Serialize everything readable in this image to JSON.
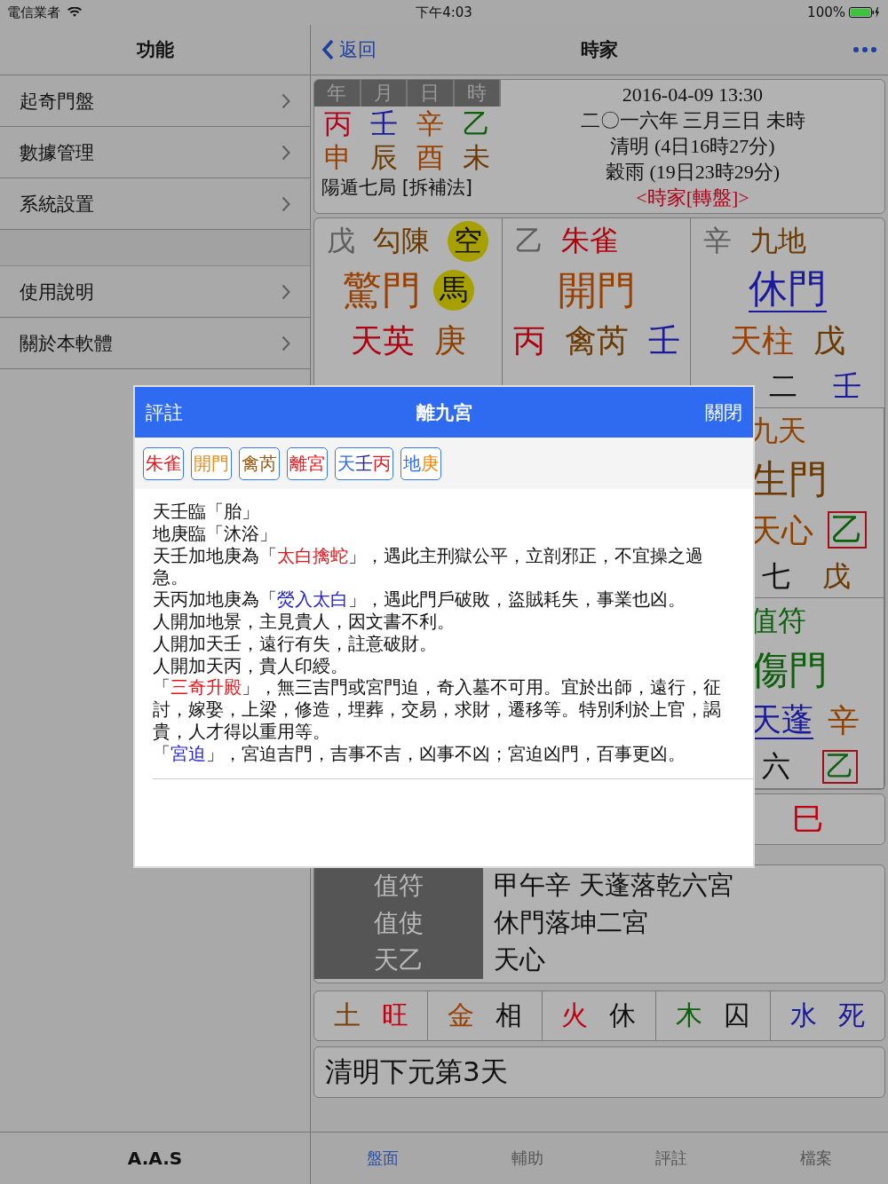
{
  "status_bar": {
    "carrier": "電信業者",
    "time": "下午4:03",
    "battery": "100%"
  },
  "sidebar": {
    "title": "功能",
    "groups": [
      [
        {
          "label": "起奇門盤"
        },
        {
          "label": "數據管理"
        },
        {
          "label": "系統設置"
        }
      ],
      [
        {
          "label": "使用說明"
        },
        {
          "label": "關於本軟體"
        }
      ]
    ],
    "footer": "A.A.S"
  },
  "nav": {
    "back": "返回",
    "title": "時家"
  },
  "chart_info": {
    "pillar_headers": [
      "年",
      "月",
      "日",
      "時"
    ],
    "stems": [
      {
        "text": "丙",
        "color": "#b0001a"
      },
      {
        "text": "壬",
        "color": "#1a1a9a"
      },
      {
        "text": "辛",
        "color": "#9a4000"
      },
      {
        "text": "乙",
        "color": "#0e600e"
      }
    ],
    "branches": [
      {
        "text": "申",
        "color": "#9a4000"
      },
      {
        "text": "辰",
        "color": "#6b3a00"
      },
      {
        "text": "酉",
        "color": "#9a4000"
      },
      {
        "text": "未",
        "color": "#6b3a00"
      }
    ],
    "ju": "陽遁七局 [拆補法]",
    "lines": [
      "2016-04-09 13:30",
      "二〇一六年 三月三日 未時",
      "清明 (4日16時27分)",
      "穀雨 (19日23時29分)"
    ],
    "link": "<時家[轉盤]>"
  },
  "palaces": [
    {
      "heaven_line": [
        {
          "text": "戊",
          "color": "#5e5e5e",
          "kind": "plain"
        },
        {
          "text": "勾陳",
          "color": "#6b3a00",
          "kind": "plain"
        },
        {
          "text": "空",
          "kind": "circle"
        }
      ],
      "door_line": [
        {
          "text": "驚門",
          "color": "#9a4000",
          "kind": "plain"
        },
        {
          "text": "馬",
          "kind": "circle"
        }
      ],
      "star_line": [
        {
          "text": "天英",
          "color": "#b0000e",
          "kind": "plain"
        },
        {
          "text": "庚",
          "color": "#8f4200",
          "kind": "plain"
        }
      ]
    },
    {
      "heaven_line": [
        {
          "text": "乙",
          "color": "#5e5e5e",
          "kind": "plain"
        },
        {
          "text": "朱雀",
          "color": "#b0000e",
          "kind": "plain"
        }
      ],
      "door_line": [
        {
          "text": "開門",
          "color": "#9a4000",
          "kind": "plain"
        }
      ],
      "star_line": [
        {
          "text": "丙",
          "color": "#b0000e",
          "kind": "plain"
        },
        {
          "text": "禽芮",
          "color": "#6b3a00",
          "kind": "plain"
        },
        {
          "text": "壬",
          "color": "#1a1a9a",
          "kind": "plain"
        }
      ]
    },
    {
      "heaven_line": [
        {
          "text": "辛",
          "color": "#5e5e5e",
          "kind": "plain"
        },
        {
          "text": "九地",
          "color": "#6b3a00",
          "kind": "plain"
        }
      ],
      "door_line": [
        {
          "text": "休門",
          "color": "#1a1a9a",
          "kind": "underlined"
        }
      ],
      "star_line": [
        {
          "text": "天柱",
          "color": "#9a4000",
          "kind": "plain"
        },
        {
          "text": "戊",
          "color": "#6b3a00",
          "kind": "plain"
        }
      ],
      "earth_line": [
        {
          "text": "二",
          "color": "#111111",
          "kind": "plain"
        },
        {
          "text": "壬",
          "color": "#1a1a9a",
          "kind": "plain"
        }
      ]
    },
    {
      "heaven_line": [
        {
          "text": "九天",
          "color": "#8f4200",
          "kind": "plain"
        }
      ],
      "door_line": [
        {
          "text": "生門",
          "color": "#6b3a00",
          "kind": "plain"
        }
      ],
      "star_line": [
        {
          "text": "天心",
          "color": "#8f4200",
          "kind": "plain"
        },
        {
          "text": "乙",
          "color": "#0e600e",
          "kind": "boxed"
        }
      ],
      "earth_line": [
        {
          "text": "七",
          "color": "#111111",
          "kind": "plain"
        },
        {
          "text": "戊",
          "color": "#6b3a00",
          "kind": "plain"
        }
      ]
    },
    {
      "heaven_line": [
        {
          "text": "值符",
          "color": "#0e600e",
          "kind": "plain"
        }
      ],
      "door_line": [
        {
          "text": "傷門",
          "color": "#0e600e",
          "kind": "plain"
        }
      ],
      "star_line": [
        {
          "text": "天蓬",
          "color": "#1a1a9a",
          "kind": "underlined"
        },
        {
          "text": "辛",
          "color": "#8f4200",
          "kind": "plain"
        }
      ],
      "earth_line": [
        {
          "text": "六",
          "color": "#111111",
          "kind": "plain"
        },
        {
          "text": "乙",
          "color": "#0e600e",
          "kind": "boxed"
        }
      ]
    }
  ],
  "branch_row": [
    {
      "text": "巳",
      "color": "#c00010"
    }
  ],
  "duty_table": [
    {
      "label": "值符",
      "value": "甲午辛 天蓬落乾六宮"
    },
    {
      "label": "值使",
      "value": "休門落坤二宮"
    },
    {
      "label": "天乙",
      "value": "天心"
    }
  ],
  "wuxing": [
    {
      "element": {
        "text": "土",
        "color": "#7a3f00"
      },
      "state": {
        "text": "旺",
        "color": "#c00010"
      }
    },
    {
      "element": {
        "text": "金",
        "color": "#9a4000"
      },
      "state": {
        "text": "相",
        "color": "#111111"
      }
    },
    {
      "element": {
        "text": "火",
        "color": "#c00010"
      },
      "state": {
        "text": "休",
        "color": "#111111"
      }
    },
    {
      "element": {
        "text": "木",
        "color": "#106010"
      },
      "state": {
        "text": "囚",
        "color": "#111111"
      }
    },
    {
      "element": {
        "text": "水",
        "color": "#1a1a9a"
      },
      "state": {
        "text": "死",
        "color": "#1a1a9a"
      }
    }
  ],
  "jieqi": "清明下元第3天",
  "tab_bar": [
    {
      "label": "盤面",
      "selected": true
    },
    {
      "label": "輔助",
      "selected": false
    },
    {
      "label": "評註",
      "selected": false
    },
    {
      "label": "檔案",
      "selected": false
    }
  ],
  "modal": {
    "left": "評註",
    "title": "離九宮",
    "close": "關閉",
    "chips": [
      [
        {
          "text": "朱雀",
          "color": "#e8141a"
        }
      ],
      [
        {
          "text": "開門",
          "color": "#f08a10"
        }
      ],
      [
        {
          "text": "禽芮",
          "color": "#9a5a10"
        }
      ],
      [
        {
          "text": "離宮",
          "color": "#e8141a"
        }
      ],
      [
        {
          "text": "天",
          "color": "#2f6bf0"
        },
        {
          "text": "壬",
          "color": "#2020a0"
        },
        {
          "text": "丙",
          "color": "#e8141a"
        }
      ],
      [
        {
          "text": "地",
          "color": "#2f6bf0"
        },
        {
          "text": "庚",
          "color": "#f08a10"
        }
      ]
    ],
    "paragraphs": [
      [
        {
          "text": "天壬臨「胎」"
        }
      ],
      [
        {
          "text": "地庚臨「沐浴」"
        }
      ],
      [
        {
          "text": "天壬加地庚為「"
        },
        {
          "text": "太白擒蛇",
          "color": "#e8141a"
        },
        {
          "text": "」，遇此主刑獄公平，立剖邪正，不宜操之過急。"
        }
      ],
      [
        {
          "text": "天丙加地庚為「"
        },
        {
          "text": "熒入太白",
          "color": "#2020e0"
        },
        {
          "text": "」，遇此門戶破敗，盜賊耗失，事業也凶。"
        }
      ],
      [
        {
          "text": "人開加地景，主見貴人，因文書不利。"
        }
      ],
      [
        {
          "text": "人開加天壬，遠行有失，註意破財。"
        }
      ],
      [
        {
          "text": "人開加天丙，貴人印綬。"
        }
      ],
      [
        {
          "text": "「"
        },
        {
          "text": "三奇升殿",
          "color": "#e8141a"
        },
        {
          "text": "」，無三吉門或宮門迫，奇入墓不可用。宜於出師，遠行，征討，嫁娶，上梁，修造，埋葬，交易，求財，遷移等。特別利於上官，謁貴，人才得以重用等。"
        }
      ],
      [
        {
          "text": "「"
        },
        {
          "text": "宮迫",
          "color": "#2020e0"
        },
        {
          "text": "」，宮迫吉門，吉事不吉，凶事不凶；宮迫凶門，百事更凶。"
        }
      ]
    ]
  }
}
